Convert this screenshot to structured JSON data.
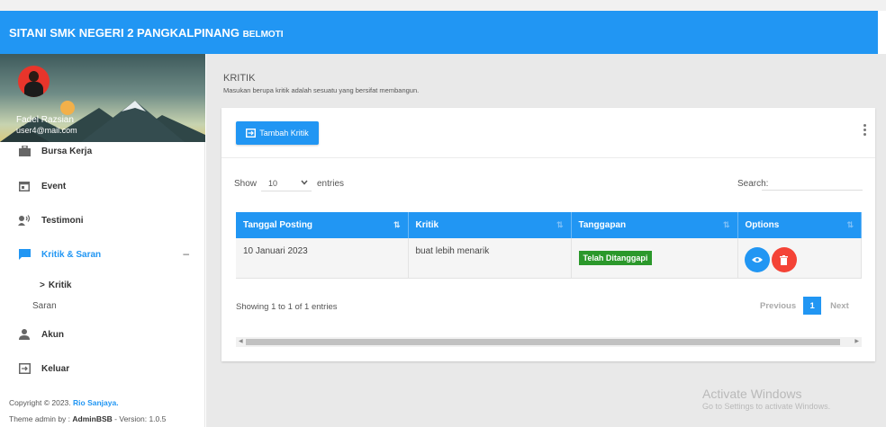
{
  "header": {
    "brand": "SITANI SMK NEGERI 2 PANGKALPINANG",
    "brand_suffix": "BELMOTI"
  },
  "user": {
    "name": "Fadel Razsian",
    "email": "user4@mail.com"
  },
  "sidebar": {
    "items": [
      {
        "label": "Bursa Kerja",
        "icon": "briefcase-icon"
      },
      {
        "label": "Event",
        "icon": "calendar-icon"
      },
      {
        "label": "Testimoni",
        "icon": "speaker-icon"
      },
      {
        "label": "Kritik & Saran",
        "icon": "chat-icon",
        "active": true,
        "expand": "–"
      },
      {
        "label": "Akun",
        "icon": "person-icon"
      },
      {
        "label": "Keluar",
        "icon": "logout-icon"
      }
    ],
    "submenu": [
      {
        "label": "Kritik",
        "prefix": ">"
      },
      {
        "label": "Saran"
      }
    ],
    "footer": {
      "copyright": "Copyright © 2023.",
      "author": "Rio Sanjaya.",
      "theme_prefix": "Theme admin by :",
      "theme_name": "AdminBSB",
      "version": "- Version: 1.0.5"
    }
  },
  "page": {
    "title": "KRITIK",
    "description": "Masukan berupa kritik adalah sesuatu yang bersifat membangun."
  },
  "card": {
    "add_button": "Tambah Kritik",
    "show_label": "Show",
    "show_value": "10",
    "entries_label": "entries",
    "search_label": "Search:",
    "search_value": ""
  },
  "table": {
    "columns": [
      "Tanggal Posting",
      "Kritik",
      "Tanggapan",
      "Options"
    ],
    "rows": [
      {
        "tanggal": "10 Januari 2023",
        "kritik": "buat lebih menarik",
        "tanggapan": "Telah Ditanggapi"
      }
    ]
  },
  "pagination": {
    "info": "Showing 1 to 1 of 1 entries",
    "previous": "Previous",
    "current": "1",
    "next": "Next"
  },
  "watermark": {
    "line1": "Activate Windows",
    "line2": "Go to Settings to activate Windows."
  },
  "colors": {
    "primary": "#2196f3",
    "success": "#2b982b",
    "danger": "#f44336"
  }
}
